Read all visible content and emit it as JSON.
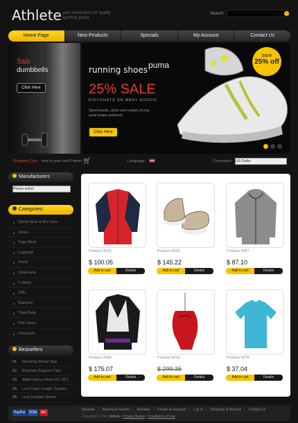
{
  "header": {
    "logo": "Athlete",
    "tagline": "your destination for quality sporting goods",
    "search_label": "Search:",
    "search_placeholder": ""
  },
  "nav": {
    "items": [
      "Home Page",
      "New Products",
      "Specials",
      "My Account",
      "Contact Us"
    ]
  },
  "banner_left": {
    "line1": "Sale",
    "line2": "dumbbells",
    "button": "Click Here"
  },
  "banner_main": {
    "title": "running shoes",
    "brand": "puma",
    "sale": "25% SALE",
    "discounts": "DISCOUNTS ON MANY GOODS!",
    "desc": "Sport brands, styles and colours of your great shape andmood",
    "button": "Click Here",
    "badge_top": "save",
    "badge_value": "25% off"
  },
  "infobar": {
    "shopping_cart": "Shopping Cart:",
    "cart_text": "now in your cart 0 items",
    "language": "Language:",
    "currencies": "Currencies:",
    "currency_value": "US Dollar"
  },
  "sidebar": {
    "manufacturers_title": "Manufacturers",
    "manufacturers_select": "Please select",
    "categories_title": "Categories:",
    "categories": [
      "Sports Bras & Bra Tops",
      "Shoes",
      "Yoga Wear",
      "Leggings",
      "Pants",
      "Underwear",
      "T-Shirts",
      "Gifts",
      "Watches",
      "Yoga Bags",
      "Plus Sizes",
      "Closeouts"
    ],
    "bestsellers_title": "Bestsellers",
    "bestsellers": [
      {
        "num": "01.",
        "name": "Shooting Winter Star"
      },
      {
        "num": "02.",
        "name": "Brazilian Supplex Pant"
      },
      {
        "num": "03.",
        "name": "AMA Fitness Wear PC SET"
      },
      {
        "num": "04.",
        "name": "Lina Capri Length Supplex"
      },
      {
        "num": "05.",
        "name": "Lina Supplex Shorts"
      }
    ]
  },
  "products": [
    {
      "name": "Product #015",
      "price": "$ 100.05",
      "old_price": "",
      "add": "Add to cart",
      "details": "Details"
    },
    {
      "name": "Product #033",
      "price": "$ 145.22",
      "old_price": "",
      "add": "Add to cart",
      "details": "Details"
    },
    {
      "name": "Product #047",
      "price": "$ 87.10",
      "old_price": "",
      "add": "Add to cart",
      "details": "Details"
    },
    {
      "name": "Product #080",
      "price": "$ 175.07",
      "old_price": "",
      "add": "Add to cart",
      "details": "Details"
    },
    {
      "name": "Product #019",
      "price": "$ 299.35",
      "old_price": "",
      "add": "Add to cart",
      "details": "Details"
    },
    {
      "name": "Product #079",
      "price": "$ 37.04",
      "old_price": "",
      "add": "Add to cart",
      "details": "Details"
    }
  ],
  "footer": {
    "payments": [
      "PayPal",
      "VISA",
      "MC"
    ],
    "links": [
      "Specials",
      "Advanced Search",
      "Reviews",
      "Create an Account",
      "Log in",
      "Shopping & Returns",
      "Contact Us"
    ],
    "copyright_pre": "Copyright © 2011",
    "copyright_brand": "Athlete",
    "privacy": "Privacy Notice",
    "conditions": "Conditions of Use"
  },
  "colors": {
    "accent": "#f6c400",
    "sale_red": "#e23b2e",
    "background": "#141414"
  }
}
